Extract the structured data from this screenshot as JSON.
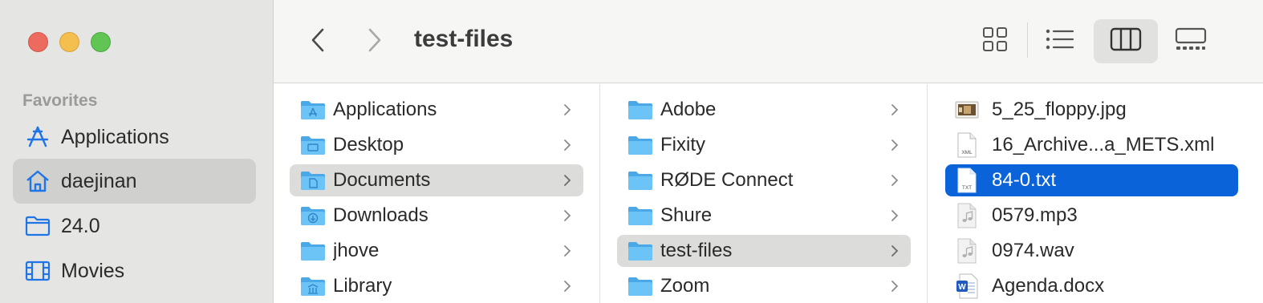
{
  "window": {
    "title": "test-files"
  },
  "sidebar": {
    "section_heading": "Favorites",
    "items": [
      {
        "label": "Applications",
        "icon": "applications-icon"
      },
      {
        "label": "daejinan",
        "icon": "home-icon",
        "selected": true
      },
      {
        "label": "24.0",
        "icon": "folder-icon"
      },
      {
        "label": "Movies",
        "icon": "film-icon"
      }
    ]
  },
  "toolbar": {
    "back_icon": "chevron-left-icon",
    "forward_icon": "chevron-right-icon",
    "views": [
      "icon-view",
      "list-view",
      "column-view",
      "gallery-view"
    ],
    "active_view": "column-view"
  },
  "columns": {
    "col1": [
      {
        "label": "Applications",
        "icon": "applications-folder-icon"
      },
      {
        "label": "Desktop",
        "icon": "desktop-folder-icon"
      },
      {
        "label": "Documents",
        "icon": "documents-folder-icon",
        "selected": true
      },
      {
        "label": "Downloads",
        "icon": "downloads-folder-icon"
      },
      {
        "label": "jhove",
        "icon": "folder-icon"
      },
      {
        "label": "Library",
        "icon": "library-folder-icon"
      }
    ],
    "col2": [
      {
        "label": "Adobe"
      },
      {
        "label": "Fixity"
      },
      {
        "label": "RØDE Connect"
      },
      {
        "label": "Shure"
      },
      {
        "label": "test-files",
        "selected": true
      },
      {
        "label": "Zoom"
      }
    ],
    "col3": [
      {
        "label": "5_25_floppy.jpg",
        "icon": "jpg-file-icon"
      },
      {
        "label": "16_Archive...a_METS.xml",
        "icon": "xml-file-icon",
        "badge": "XML"
      },
      {
        "label": "84-0.txt",
        "icon": "txt-file-icon",
        "badge": "TXT",
        "selected": true
      },
      {
        "label": "0579.mp3",
        "icon": "audio-file-icon"
      },
      {
        "label": "0974.wav",
        "icon": "audio-file-icon"
      },
      {
        "label": "Agenda.docx",
        "icon": "word-file-icon",
        "badge": "W"
      }
    ]
  },
  "colors": {
    "accent_blue": "#0a63d9",
    "folder_blue": "#5bb8f0",
    "sidebar_bg": "#e5e5e3"
  }
}
